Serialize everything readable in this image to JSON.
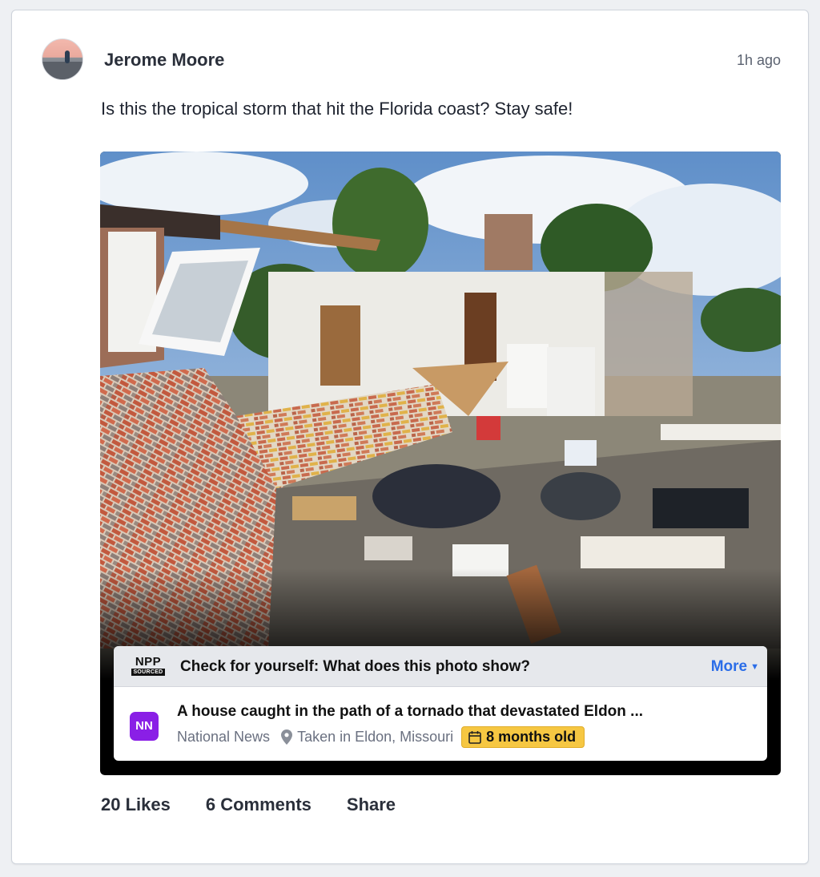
{
  "post": {
    "author": "Jerome Moore",
    "time": "1h ago",
    "text": "Is this the tropical storm that hit the Florida coast? Stay safe!"
  },
  "fact_check": {
    "logo_title": "NPP",
    "logo_sub": "SOURCED",
    "prompt": "Check for yourself: What does this photo show?",
    "more_label": "More",
    "source_badge": "NN",
    "headline": "A house caught in the path of a tornado that devastated Eldon ...",
    "source_name": "National News",
    "location": "Taken in Eldon, Missouri",
    "age": "8 months old",
    "age_color": "#f6c742",
    "badge_color": "#8a1fe6"
  },
  "actions": {
    "likes": "20 Likes",
    "comments": "6 Comments",
    "share": "Share"
  }
}
